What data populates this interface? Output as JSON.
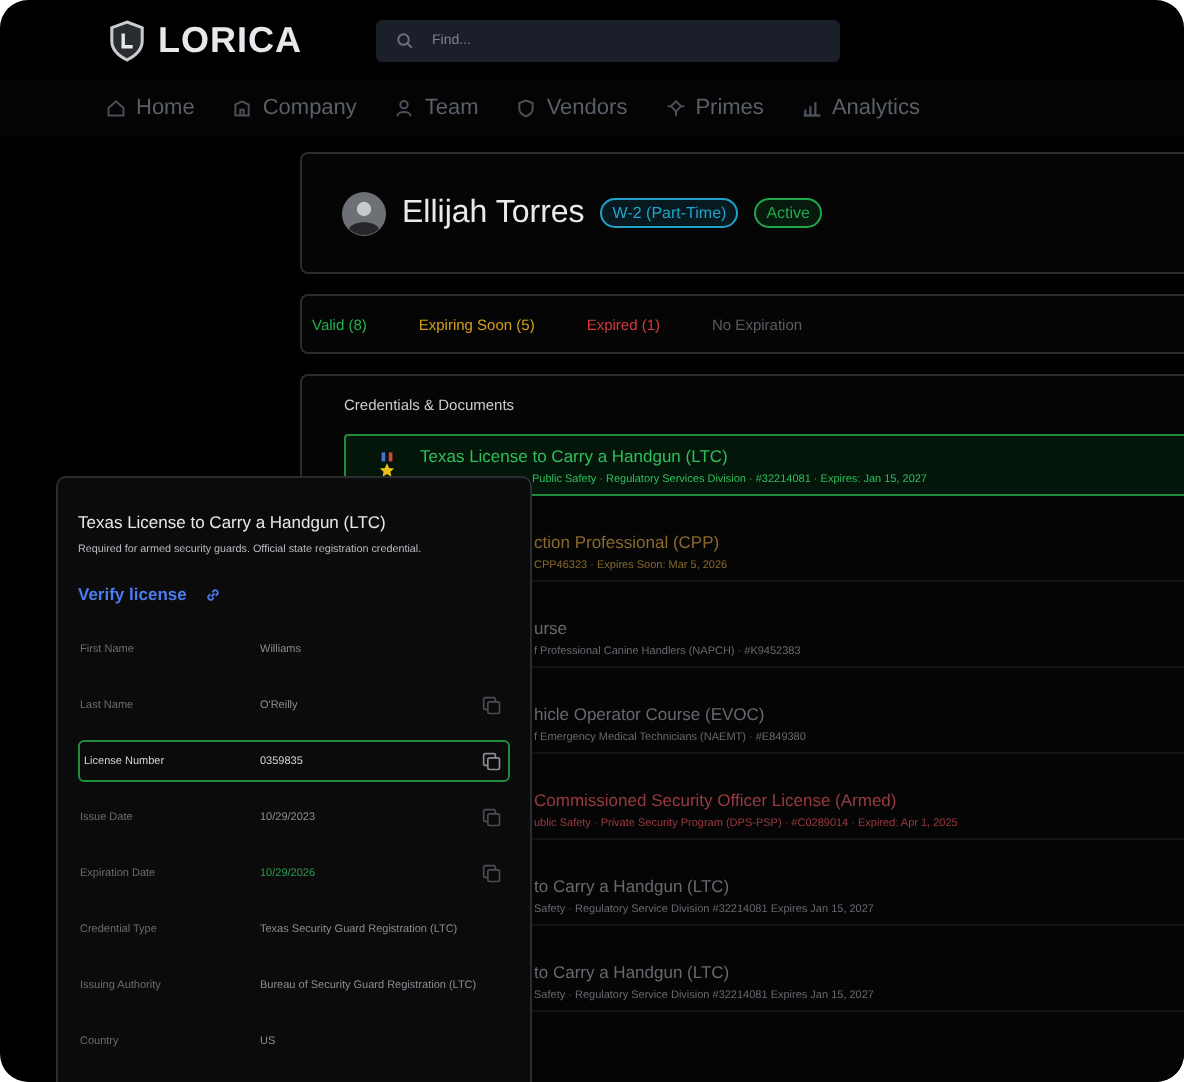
{
  "brand": {
    "name": "LORICA"
  },
  "search": {
    "placeholder": "Find..."
  },
  "nav": [
    {
      "label": "Home"
    },
    {
      "label": "Company"
    },
    {
      "label": "Team"
    },
    {
      "label": "Vendors"
    },
    {
      "label": "Primes"
    },
    {
      "label": "Analytics"
    }
  ],
  "profile": {
    "name": "Ellijah Torres",
    "badges": [
      {
        "label": "W-2 (Part-Time)",
        "color": "#1fa3c9"
      },
      {
        "label": "Active",
        "color": "#1fa84a"
      }
    ]
  },
  "filters": [
    {
      "label": "Valid (8)",
      "color": "#22b24c"
    },
    {
      "label": "Expiring Soon (5)",
      "color": "#d4a017"
    },
    {
      "label": "Expired (1)",
      "color": "#d9363e"
    },
    {
      "label": "No Expiration",
      "color": "#5a5d63"
    }
  ],
  "credentials": {
    "title": "Credentials & Documents",
    "rows": [
      {
        "title": "Texas License to Carry a Handgun (LTC)",
        "detail": "Public Safety · Regulatory Services Division · #32214081 · Expires: Jan 15, 2027",
        "color": "#2fbf5a",
        "selected": true
      },
      {
        "title": "ction Professional (CPP)",
        "detail": "CPP46323 · Expires Soon: Mar 5, 2026",
        "color": "#8a6a2c",
        "selected": false
      },
      {
        "title": "urse",
        "detail": "f Professional Canine Handlers (NAPCH) · #K9452383",
        "color": "#66696f",
        "selected": false
      },
      {
        "title": "hicle Operator Course (EVOC)",
        "detail": "f Emergency Medical Technicians (NAEMT) · #E849380",
        "color": "#66696f",
        "selected": false
      },
      {
        "title": "Commissioned Security Officer License (Armed)",
        "detail": "ublic Safety · Private Security Program (DPS-PSP) · #C0289014 · Expired: Apr 1, 2025",
        "color": "#9a3a40",
        "selected": false
      },
      {
        "title": "to Carry a Handgun (LTC)",
        "detail": "Safety · Regulatory Service Division #32214081 Expires Jan 15, 2027",
        "color": "#66696f",
        "selected": false
      },
      {
        "title": "to Carry a Handgun (LTC)",
        "detail": "Safety · Regulatory Service Division #32214081 Expires Jan 15, 2027",
        "color": "#66696f",
        "selected": false
      }
    ]
  },
  "popup": {
    "title": "Texas License to Carry a Handgun (LTC)",
    "description": "Required for armed security guards. Official state registration credential.",
    "link": "Verify license",
    "fields": [
      {
        "label": "First Name",
        "value": "Williams",
        "copy": false,
        "selected": false
      },
      {
        "label": "Last Name",
        "value": "O'Reilly",
        "copy": true,
        "selected": false
      },
      {
        "label": "License Number",
        "value": "0359835",
        "copy": true,
        "selected": true
      },
      {
        "label": "Issue Date",
        "value": "10/29/2023",
        "copy": true,
        "selected": false
      },
      {
        "label": "Expiration Date",
        "value": "10/29/2026",
        "copy": true,
        "selected": false,
        "color": "#2a9a4c"
      },
      {
        "label": "Credential Type",
        "value": "Texas Security Guard Registration (LTC)",
        "copy": false,
        "selected": false
      },
      {
        "label": "Issuing Authority",
        "value": "Bureau of Security Guard Registration (LTC)",
        "copy": false,
        "selected": false
      },
      {
        "label": "Country",
        "value": "US",
        "copy": false,
        "selected": false
      }
    ]
  }
}
